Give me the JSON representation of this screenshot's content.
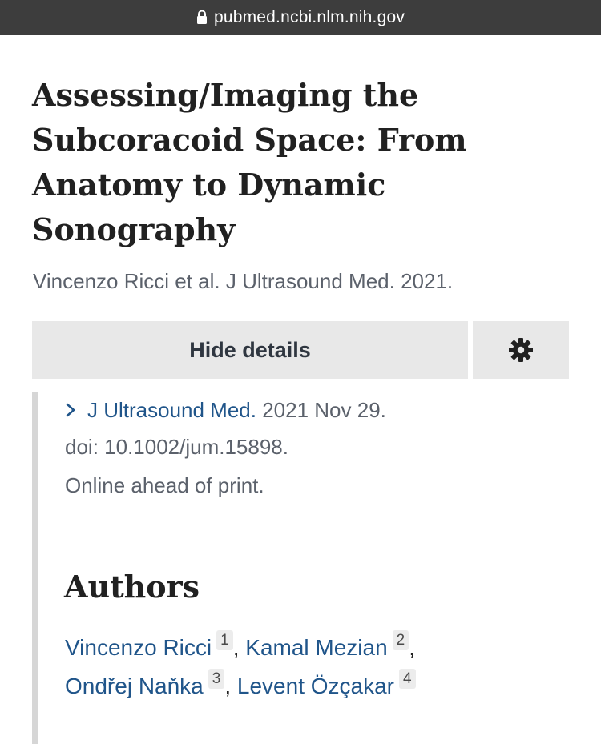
{
  "browser": {
    "url": "pubmed.ncbi.nlm.nih.gov",
    "lock_icon": "lock-icon"
  },
  "article": {
    "title": "Assessing/Imaging the Subcoracoid Space: From Anatomy to Dynamic Sonography",
    "short_citation": "Vincenzo Ricci et al. J Ultrasound Med. 2021."
  },
  "controls": {
    "details_label": "Hide details",
    "settings_icon": "gear-icon"
  },
  "details": {
    "journal_icon": "chevron-right-icon",
    "journal": "J Ultrasound Med.",
    "date": "2021 Nov 29.",
    "doi": "doi: 10.1002/jum.15898.",
    "status": "Online ahead of print."
  },
  "authors": {
    "heading": "Authors",
    "list": [
      {
        "name": "Vincenzo Ricci",
        "affiliation": "1"
      },
      {
        "name": "Kamal Mezian",
        "affiliation": "2"
      },
      {
        "name": "Ondřej Naňka",
        "affiliation": "3"
      },
      {
        "name": "Levent Özçakar",
        "affiliation": "4"
      }
    ],
    "separator": ","
  },
  "colors": {
    "url_bar_bg": "#3d3d3d",
    "link": "#20558a",
    "muted_text": "#5b616b",
    "button_bg": "#e8e8e8"
  }
}
